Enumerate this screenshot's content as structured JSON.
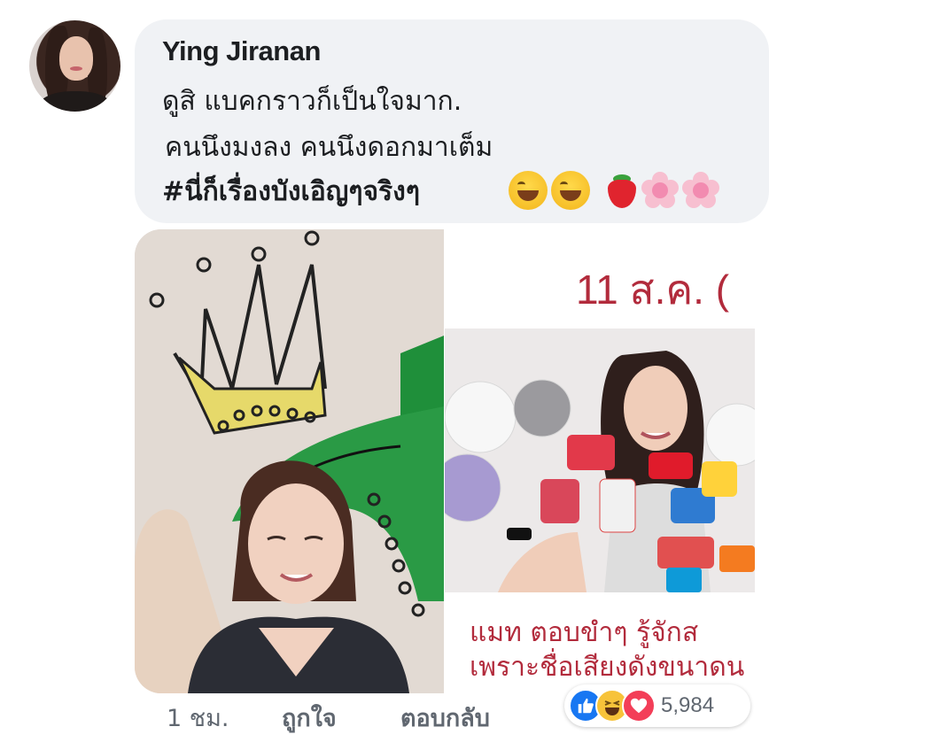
{
  "comment": {
    "author": "Ying Jiranan",
    "text_line1": "ดูสิ แบคกราวก็เป็นใจมาก.",
    "text_line2": "คนนึงมงลง คนนึงดอกมาเต็ม",
    "text_line3": "#นี่ก็เรื่องบังเอิญๆจริงๆ",
    "emojis": [
      "laughing-tears",
      "laughing-tears",
      "strawberry",
      "cherry-blossom",
      "cherry-blossom"
    ]
  },
  "image": {
    "right_header": "11 ส.ค. (",
    "right_caption_line1": "แมท   ตอบขำๆ  รู้จักส",
    "right_caption_line2": "เพราะชื่อเสียงดังขนาดน",
    "left_scene": "crown-mural-selfie",
    "right_scene": "press-interview-with-mics"
  },
  "footer": {
    "time": "1 ชม.",
    "like_label": "ถูกใจ",
    "reply_label": "ตอบกลับ"
  },
  "reactions": {
    "types": [
      "like",
      "haha",
      "love"
    ],
    "count": "5,984"
  },
  "colors": {
    "bubble_bg": "#f0f2f5",
    "text_primary": "#1c1e21",
    "text_secondary": "#606770",
    "caption_red": "#b22b3c",
    "like_blue": "#1877f2",
    "love_red": "#f33e58"
  }
}
